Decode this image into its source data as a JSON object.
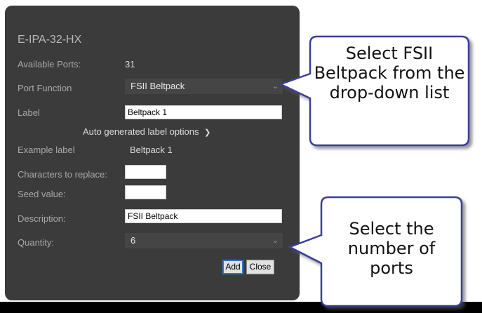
{
  "dialog": {
    "title": "E-IPA-32-HX",
    "available_ports_label": "Available Ports:",
    "available_ports_value": "31",
    "port_function_label": "Port Function",
    "port_function_value": "FSII Beltpack",
    "label_label": "Label",
    "label_value": "Beltpack 1",
    "auto_options_text": "Auto generated label options",
    "example_label_label": "Example label",
    "example_label_value": "Beltpack 1",
    "chars_replace_label": "Characters to replace:",
    "chars_replace_value": "",
    "seed_label": "Seed value:",
    "seed_value": "",
    "description_label": "Description:",
    "description_value": "FSII Beltpack",
    "quantity_label": "Quantity:",
    "quantity_value": "6",
    "add_button": "Add",
    "close_button": "Close"
  },
  "callouts": {
    "top_text": "Select FSII Beltpack from the drop-down list",
    "bottom_text": "Select the number of ports"
  },
  "icons": {
    "dropdown_chevron": "chevron-down-icon",
    "options_chevron": "chevron-down-icon"
  },
  "colors": {
    "dialog_bg": "#3b3b3b",
    "callout_fill": "#ffffff",
    "callout_border": "#3d3d99",
    "button_focus": "#2f74d0"
  }
}
